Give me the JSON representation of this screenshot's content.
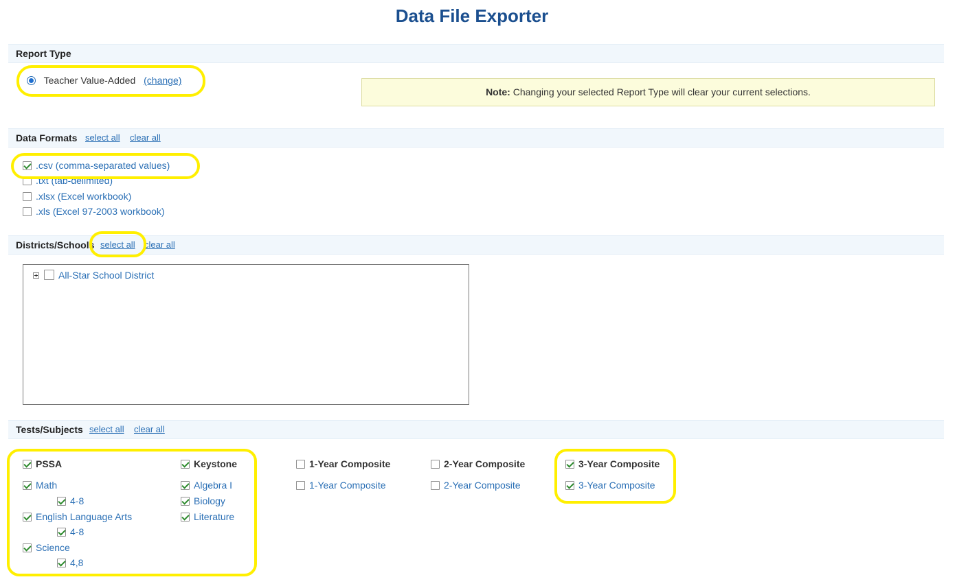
{
  "page_title": "Data File Exporter",
  "report_type": {
    "title": "Report Type",
    "selected": "Teacher Value-Added",
    "change_link": "(change)",
    "note_label": "Note:",
    "note_text": " Changing your selected Report Type will clear your current selections."
  },
  "data_formats": {
    "title": "Data Formats",
    "select_all": "select all",
    "clear_all": "clear all",
    "options": [
      {
        "label": ".csv (comma-separated values)",
        "checked": true
      },
      {
        "label": ".txt (tab-delimited)",
        "checked": false
      },
      {
        "label": ".xlsx (Excel workbook)",
        "checked": false
      },
      {
        "label": ".xls (Excel 97-2003 workbook)",
        "checked": false
      }
    ]
  },
  "districts": {
    "title": "Districts/Schools",
    "select_all": "select all",
    "clear_all": "clear all",
    "tree": [
      {
        "label": "All-Star School District",
        "checked": false
      }
    ]
  },
  "tests": {
    "title": "Tests/Subjects",
    "select_all": "select all",
    "clear_all": "clear all",
    "pssa": {
      "label": "PSSA",
      "items": [
        {
          "label": "Math",
          "sub": "4-8"
        },
        {
          "label": "English Language Arts",
          "sub": "4-8"
        },
        {
          "label": "Science",
          "sub": "4,8"
        }
      ]
    },
    "keystone": {
      "label": "Keystone",
      "items": [
        "Algebra I",
        "Biology",
        "Literature"
      ]
    },
    "composite_1": {
      "header": "1-Year Composite",
      "item": "1-Year Composite",
      "checked": false
    },
    "composite_2": {
      "header": "2-Year Composite",
      "item": "2-Year Composite",
      "checked": false
    },
    "composite_3": {
      "header": "3-Year Composite",
      "item": "3-Year Composite",
      "checked": true
    }
  },
  "colors": {
    "title": "#1b4f8f",
    "link": "#2a6fb5",
    "section_bg": "#f1f7fc",
    "highlight": "#ffef00",
    "note_bg": "#fcfcdc"
  }
}
